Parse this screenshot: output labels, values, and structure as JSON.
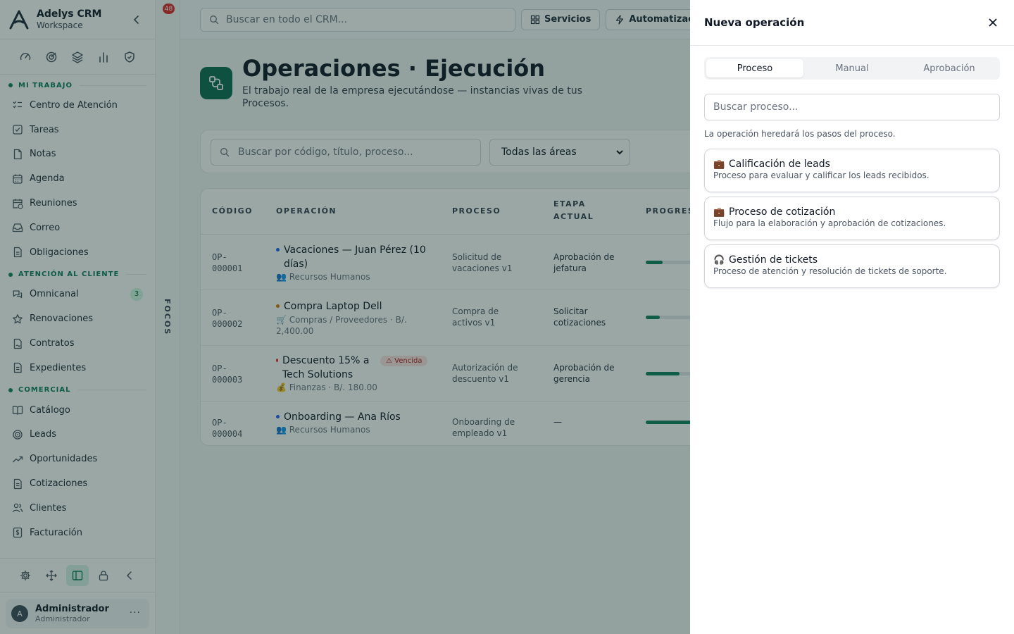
{
  "sidebar": {
    "brand_name": "Adelys CRM",
    "brand_sub": "Workspace",
    "quick_icons": [
      "gauge-icon",
      "target-icon",
      "layers-icon",
      "bar-chart-icon",
      "shield-check-icon"
    ],
    "sections": [
      {
        "title": "MI TRABAJO",
        "items": [
          {
            "label": "Centro de Atención",
            "icon": "list-check-icon"
          },
          {
            "label": "Tareas",
            "icon": "checkbox-icon"
          },
          {
            "label": "Notas",
            "icon": "file-icon"
          },
          {
            "label": "Agenda",
            "icon": "calendar-icon"
          },
          {
            "label": "Reuniones",
            "icon": "calendar-clock-icon"
          },
          {
            "label": "Correo",
            "icon": "inbox-icon"
          },
          {
            "label": "Obligaciones",
            "icon": "document-icon"
          }
        ]
      },
      {
        "title": "ATENCIÓN AL CLIENTE",
        "items": [
          {
            "label": "Omnicanal",
            "icon": "chat-icon",
            "badge": "3"
          },
          {
            "label": "Renovaciones",
            "icon": "star-icon"
          },
          {
            "label": "Contratos",
            "icon": "contract-icon"
          },
          {
            "label": "Expedientes",
            "icon": "folder-icon"
          }
        ]
      },
      {
        "title": "COMERCIAL",
        "items": [
          {
            "label": "Catálogo",
            "icon": "book-icon"
          },
          {
            "label": "Leads",
            "icon": "target-icon"
          },
          {
            "label": "Oportunidades",
            "icon": "trending-up-icon"
          },
          {
            "label": "Cotizaciones",
            "icon": "receipt-icon"
          },
          {
            "label": "Clientes",
            "icon": "users-icon"
          },
          {
            "label": "Facturación",
            "icon": "invoice-icon"
          }
        ]
      }
    ],
    "bottom_tools": [
      "settings-icon",
      "move-icon",
      "panel-icon",
      "lock-icon",
      "chevron-left-icon"
    ],
    "user": {
      "initial": "A",
      "name": "Administrador",
      "role": "Administrador"
    }
  },
  "rail": {
    "badge": "48",
    "label": "FOCOS"
  },
  "topbar": {
    "search_placeholder": "Buscar en todo el CRM...",
    "buttons": [
      "Servicios",
      "Automatizacio"
    ]
  },
  "page": {
    "title": "Operaciones · Ejecución",
    "subtitle": "El trabajo real de la empresa ejecutándose — instancias vivas de tus Procesos.",
    "filter_search_placeholder": "Buscar por código, título, proceso...",
    "area_select": "Todas las áreas"
  },
  "table": {
    "headers": {
      "code": "CÓDIGO",
      "operation": "OPERACIÓN",
      "process": "PROCESO",
      "stage_1": "ETAPA",
      "stage_2": "ACTUAL",
      "progress": "PROGRES"
    },
    "rows": [
      {
        "code_1": "OP-",
        "code_2": "000001",
        "title": "Vacaciones — Juan Pérez (10 días)",
        "dot": "#2563eb",
        "meta": "👥 Recursos Humanos",
        "process": "Solicitud de vacaciones v1",
        "stage": "Aprobación de jefatura",
        "progress": 0.2
      },
      {
        "code_1": "OP-",
        "code_2": "000002",
        "title": "Compra Laptop Dell",
        "dot": "#d97706",
        "meta": "🛒 Compras / Proveedores · B/. 2,400.00",
        "process": "Compra de activos v1",
        "stage": "Solicitar cotizaciones",
        "progress": 0.17
      },
      {
        "code_1": "OP-",
        "code_2": "000003",
        "title": "Descuento 15% a Tech Solutions",
        "dot": "#dc2626",
        "meta": "💰 Finanzas · B/. 180.00",
        "badge": "⚠ Vencida",
        "process": "Autorización de descuento v1",
        "stage": "Aprobación de gerencia",
        "progress": 0.4
      },
      {
        "code_1": "OP-",
        "code_2": "000004",
        "title": "Onboarding — Ana Ríos",
        "dot": "#2563eb",
        "meta": "👥 Recursos Humanos",
        "process": "Onboarding de empleado v1",
        "stage": "—",
        "progress": 0.55
      }
    ]
  },
  "drawer": {
    "title": "Nueva operación",
    "tabs": [
      "Proceso",
      "Manual",
      "Aprobación"
    ],
    "active_tab": "Proceso",
    "search_placeholder": "Buscar proceso...",
    "hint": "La operación heredará los pasos del proceso.",
    "processes": [
      {
        "emoji": "💼",
        "name": "Calificación de leads",
        "desc": "Proceso para evaluar y calificar los leads recibidos."
      },
      {
        "emoji": "💼",
        "name": "Proceso de cotización",
        "desc": "Flujo para la elaboración y aprobación de cotizaciones."
      },
      {
        "emoji": "🎧",
        "name": "Gestión de tickets",
        "desc": "Proceso de atención y resolución de tickets de soporte."
      }
    ]
  },
  "colors": {
    "accent": "#12805f",
    "accent_dark": "#0f6b52",
    "danger": "#dc2626"
  }
}
